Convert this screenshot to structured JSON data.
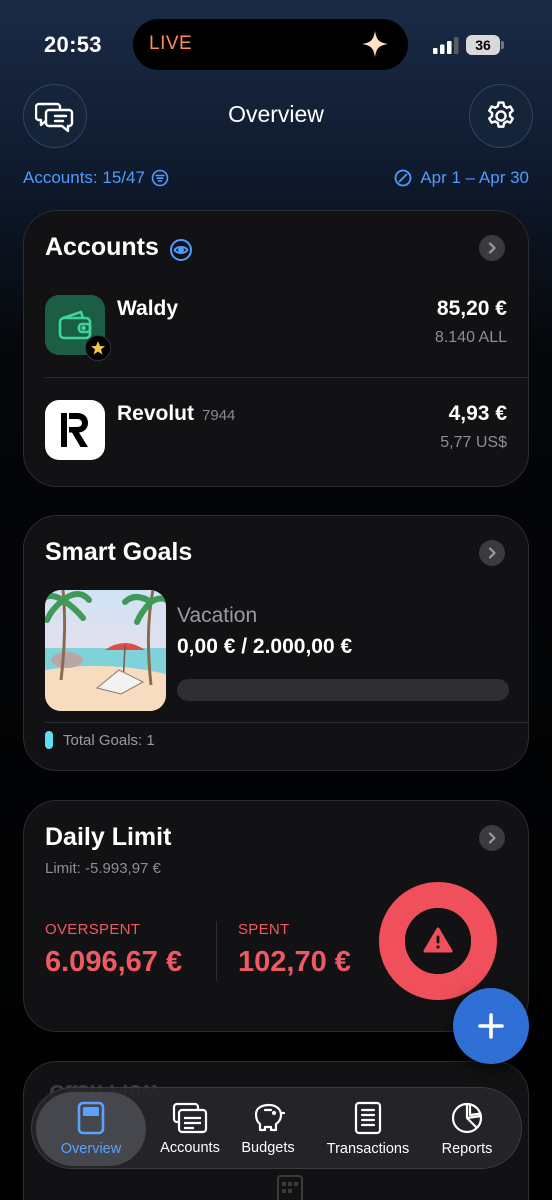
{
  "status_bar": {
    "time": "20:53",
    "live_label": "LIVE",
    "battery": "36"
  },
  "header": {
    "title": "Overview"
  },
  "filters": {
    "accounts": "Accounts: 15/47",
    "date_range": "Apr 1 – Apr 30"
  },
  "accounts_card": {
    "title": "Accounts",
    "items": [
      {
        "name": "Waldy",
        "number": "",
        "amount": "85,20 €",
        "secondary": "8.140 ALL",
        "favorite": true
      },
      {
        "name": "Revolut",
        "number": "7944",
        "amount": "4,93 €",
        "secondary": "5,77 US$",
        "favorite": false
      }
    ]
  },
  "goals_card": {
    "title": "Smart Goals",
    "goal": {
      "name": "Vacation",
      "amount": "0,00 € / 2.000,00 €",
      "progress": 0
    },
    "total": "Total Goals: 1"
  },
  "limit_card": {
    "title": "Daily Limit",
    "limit": "Limit: -5.993,97 €",
    "overspent_label": "OVERSPENT",
    "overspent_value": "6.096,67 €",
    "spent_label": "SPENT",
    "spent_value": "102,70 €"
  },
  "peek_card": {
    "title": "Cash Flow"
  },
  "tabs": [
    {
      "label": "Overview",
      "active": true
    },
    {
      "label": "Accounts",
      "active": false
    },
    {
      "label": "Budgets",
      "active": false
    },
    {
      "label": "Transactions",
      "active": false
    },
    {
      "label": "Reports",
      "active": false
    }
  ],
  "colors": {
    "accent": "#4f9bff",
    "danger": "#ee5a63",
    "goal": "#56d8f0",
    "fab": "#2f6fd6"
  }
}
